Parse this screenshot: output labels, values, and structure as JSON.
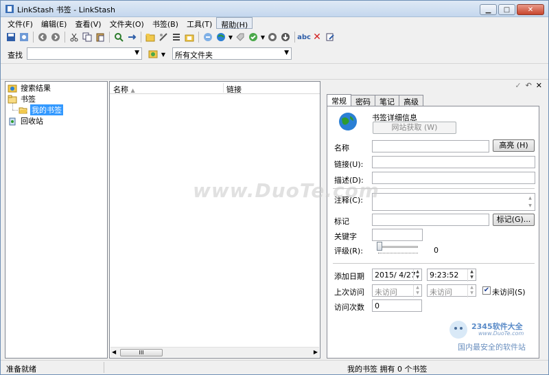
{
  "window": {
    "title": "LinkStash 书签 - LinkStash"
  },
  "menu": [
    {
      "label": "文件(F)"
    },
    {
      "label": "编辑(E)"
    },
    {
      "label": "查看(V)"
    },
    {
      "label": "文件夹(O)"
    },
    {
      "label": "书签(B)"
    },
    {
      "label": "工具(T)"
    },
    {
      "label": "帮助(H)"
    }
  ],
  "search": {
    "label": "查找",
    "query": "",
    "scope": "所有文件夹"
  },
  "tree": [
    {
      "label": "搜索结果",
      "icon": "search-results-icon"
    },
    {
      "label": "书签",
      "icon": "folder-icon"
    },
    {
      "label": "我的书签",
      "icon": "open-folder-icon"
    },
    {
      "label": "回收站",
      "icon": "recycle-bin-icon"
    }
  ],
  "list": {
    "columns": [
      "名称",
      "链接"
    ],
    "sort_indicator": "▲"
  },
  "detail": {
    "tabs": [
      "常规",
      "密码",
      "笔记",
      "高级"
    ],
    "header_title": "书签详细信息",
    "fetch_button": "网站获取 (W)",
    "fields": {
      "name_label": "名称",
      "highlight_button": "高亮 (H)",
      "link_label": "链接(U):",
      "desc_label": "描述(D):",
      "notes_label": "注释(C):",
      "tag_label": "标记",
      "tag_button": "标记(G)...",
      "keyword_label": "关键字",
      "rating_label": "评级(R):",
      "rating_value": "0",
      "added_label": "添加日期",
      "added_date": "2015/ 4/27",
      "added_time": "9:23:52",
      "last_visit_label": "上次访问",
      "last_visit_date": "未访问",
      "last_visit_time": "未访问",
      "not_visited_label": "未访问(S)",
      "visits_label": "访问次数",
      "visits_value": "0"
    }
  },
  "status": {
    "left": "准备就绪",
    "right": "我的书签 拥有 0 个书签"
  },
  "watermark": "www.DuoTe.com",
  "corner_logo": {
    "line1": "2345软件大全",
    "line2": "www.DuoTe.com",
    "line3": "国内最安全的软件站"
  },
  "colors": {
    "selection": "#3399ff",
    "close_button": "#c7452d",
    "globe": "#2a7fd4"
  }
}
